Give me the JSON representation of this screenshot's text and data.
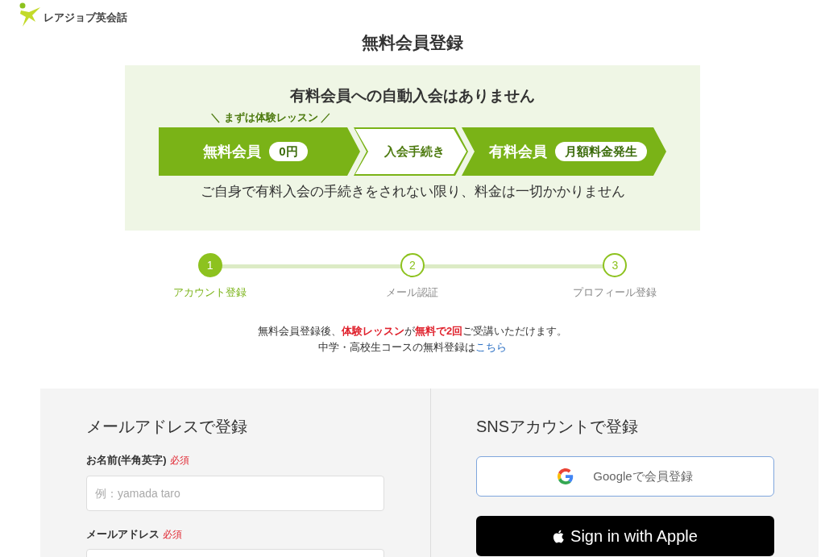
{
  "logo": {
    "text": "レアジョブ英会話"
  },
  "title": "無料会員登録",
  "notice_box": {
    "heading": "有料会員への自動入会はありません",
    "tagline": "＼ まずは体験レッスン ／",
    "flow": [
      {
        "kind": "filled",
        "label": "無料会員",
        "badge": "0円"
      },
      {
        "kind": "outline",
        "label": "入会手続き"
      },
      {
        "kind": "filled",
        "label": "有料会員",
        "badge": "月額料金発生"
      }
    ],
    "note": "ご自身で有料入会の手続きをされない限り、料金は一切かかりません"
  },
  "steps": [
    {
      "number": "1",
      "label": "アカウント登録",
      "selected": true
    },
    {
      "number": "2",
      "label": "メール認証",
      "selected": false
    },
    {
      "number": "3",
      "label": "プロフィール登録",
      "selected": false
    }
  ],
  "info": {
    "line": "無料会員登録後、**体験レッスン**が**無料で2回**ご受講いただけます。",
    "link_prefix": "中学・高校生コースの無料登録は",
    "link": "こちら"
  },
  "email_form": {
    "heading": "メールアドレスで登録",
    "fields": [
      {
        "label": "お名前(半角英字)",
        "required": "必須",
        "placeholder": "例：yamada taro"
      },
      {
        "label": "メールアドレス",
        "required": "必須"
      }
    ]
  },
  "sns": {
    "heading": "SNSアカウントで登録",
    "buttons": [
      {
        "kind": "google",
        "label": "Googleで会員登録"
      },
      {
        "kind": "apple",
        "label": "Sign in with Apple"
      }
    ]
  }
}
